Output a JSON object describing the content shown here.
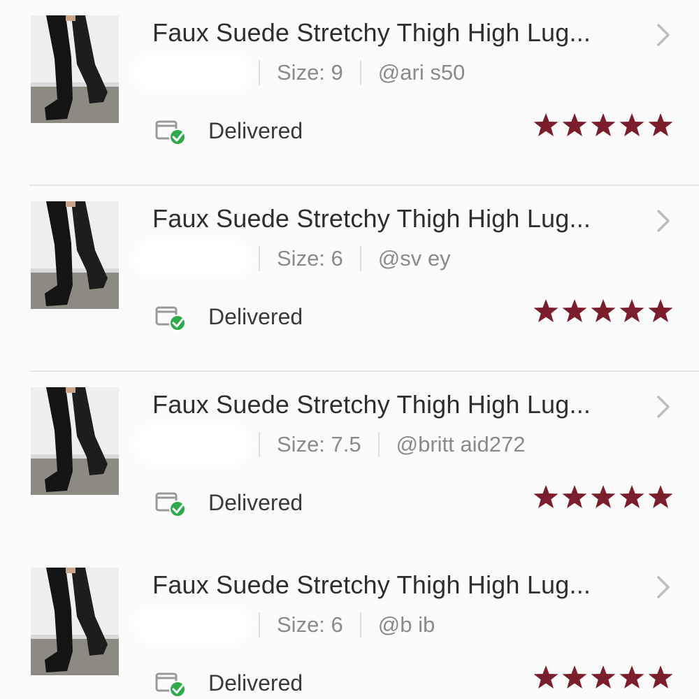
{
  "colors": {
    "star": "#7b1e2b",
    "title_text": "#2e2e2e",
    "meta_text": "#8a8a8a",
    "delivered_check": "#2faa4a"
  },
  "orders": [
    {
      "title": "Faux Suede Stretchy Thigh High Lug...",
      "size": "Size: 9",
      "user": "@ari  s50",
      "status": "Delivered",
      "rating": 5,
      "thumbnail_icon": "thigh-high-boots-image",
      "status_icon": "package-delivered-icon",
      "chevron_icon": "chevron-right-icon"
    },
    {
      "title": "Faux Suede Stretchy Thigh High Lug...",
      "size": "Size: 6",
      "user": "@sv   ey",
      "status": "Delivered",
      "rating": 5,
      "thumbnail_icon": "thigh-high-boots-image",
      "status_icon": "package-delivered-icon",
      "chevron_icon": "chevron-right-icon"
    },
    {
      "title": "Faux Suede Stretchy Thigh High Lug...",
      "size": "Size: 7.5",
      "user": "@britt      aid272",
      "status": "Delivered",
      "rating": 5,
      "thumbnail_icon": "thigh-high-boots-image",
      "status_icon": "package-delivered-icon",
      "chevron_icon": "chevron-right-icon"
    },
    {
      "title": "Faux Suede Stretchy Thigh High Lug...",
      "size": "Size: 6",
      "user": "@b  ib",
      "status": "Delivered",
      "rating": 5,
      "thumbnail_icon": "thigh-high-boots-image",
      "status_icon": "package-delivered-icon",
      "chevron_icon": "chevron-right-icon"
    }
  ]
}
